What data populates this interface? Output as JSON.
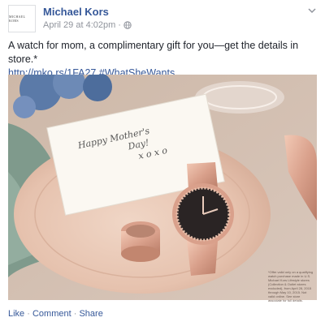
{
  "post": {
    "avatar_text": "MICHAEL KORS",
    "page_name": "Michael Kors",
    "timestamp": "April 29 at 4:02pm",
    "separator": "·",
    "privacy_icon": "globe-icon",
    "menu_icon": "chevron-down-icon",
    "message_text": "A watch for mom, a complimentary gift for you—get the details in store.*",
    "link_text": "http://mko.rs/1FA27",
    "hashtag_text": "#WhatSheWants",
    "photo": {
      "card_line1": "Happy Mother's",
      "card_line2": "Day!",
      "card_line3": "x o x o",
      "disclaimer": "*Offer valid only on a qualifying watch purchase made in U.S. Michael Kors Lifestyle stores (Collection & Outlet stores excluded), from April 28, 2015 through May 10, 2015. Not valid online. See store associate for full details."
    },
    "actions": {
      "like": "Like",
      "dot1": "·",
      "comment": "Comment",
      "dot2": "·",
      "share": "Share"
    }
  },
  "colors": {
    "brand_link": "#365899",
    "meta_gray": "#90949c",
    "text": "#1d2129",
    "rose_gold": "#d9a08b"
  }
}
